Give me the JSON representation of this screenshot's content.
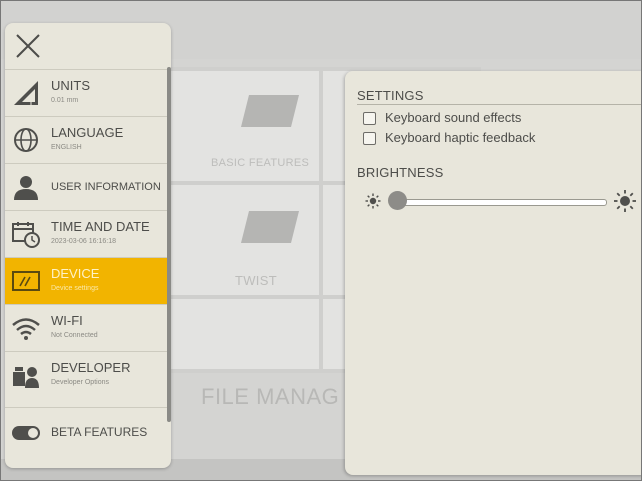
{
  "background_app": {
    "tiles": [
      {
        "label": "BASIC FEATURES"
      },
      {
        "label": "TWIST"
      }
    ],
    "file_manager_label": "FILE MANAG"
  },
  "menu": {
    "close_icon": "close-x-icon",
    "items": [
      {
        "label": "UNITS",
        "sublabel": "0.01 mm",
        "icon": "ruler-triangle-icon",
        "active": false
      },
      {
        "label": "LANGUAGE",
        "sublabel": "ENGLISH",
        "icon": "globe-icon",
        "active": false
      },
      {
        "label": "USER INFORMATION",
        "sublabel": "",
        "icon": "user-icon",
        "active": false
      },
      {
        "label": "TIME AND DATE",
        "sublabel": "2023-03-06 16:16:18",
        "icon": "calendar-clock-icon",
        "active": false
      },
      {
        "label": "DEVICE",
        "sublabel": "Device settings",
        "icon": "device-screen-icon",
        "active": true
      },
      {
        "label": "WI-FI",
        "sublabel": "Not Connected",
        "icon": "wifi-icon",
        "active": false
      },
      {
        "label": "DEVELOPER",
        "sublabel": "Developer Options",
        "icon": "developer-icon",
        "active": false
      },
      {
        "label": "BETA FEATURES",
        "sublabel": "",
        "icon": "toggle-icon",
        "active": false
      }
    ],
    "active_color": "#f2b400"
  },
  "settings": {
    "title": "SETTINGS",
    "options": [
      {
        "label": "Keyboard sound effects",
        "checked": false
      },
      {
        "label": "Keyboard haptic feedback",
        "checked": false
      }
    ],
    "brightness": {
      "title": "BRIGHTNESS",
      "value": 0,
      "min_icon": "sun-small-icon",
      "max_icon": "sun-large-icon"
    }
  }
}
